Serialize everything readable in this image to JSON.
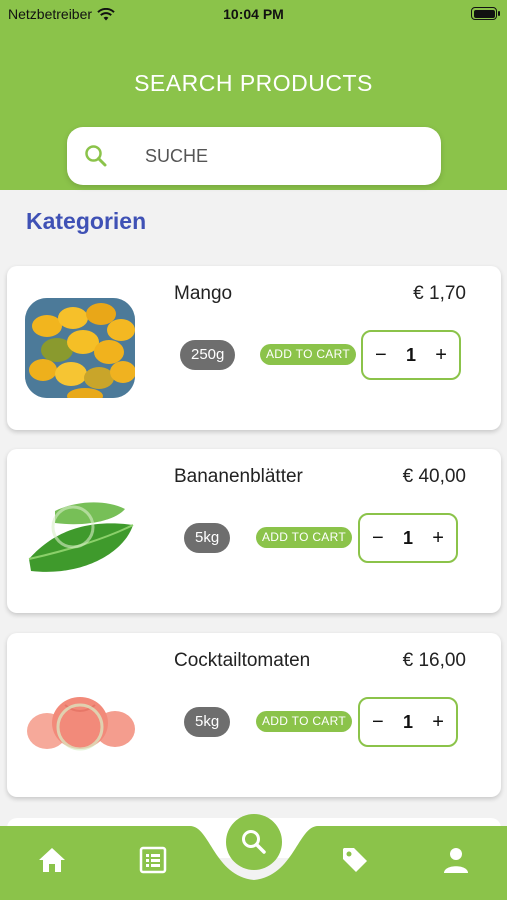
{
  "status_bar": {
    "carrier": "Netzbetreiber",
    "time": "10:04 PM"
  },
  "header": {
    "title": "SEARCH PRODUCTS"
  },
  "search": {
    "placeholder": "SUCHE"
  },
  "section": {
    "title": "Kategorien"
  },
  "colors": {
    "brand_green": "#8bc34a",
    "category_blue": "#3f51b5",
    "badge_grey": "#6e6e6e"
  },
  "products": [
    {
      "name": "Mango",
      "price": "€ 1,70",
      "weight": "250g",
      "add_label": "ADD TO CART",
      "quantity": "1",
      "minus": "−",
      "plus": "+"
    },
    {
      "name": "Bananenblätter",
      "price": "€ 40,00",
      "weight": "5kg",
      "add_label": "ADD TO CART",
      "quantity": "1",
      "minus": "−",
      "plus": "+"
    },
    {
      "name": "Cocktailtomaten",
      "price": "€ 16,00",
      "weight": "5kg",
      "add_label": "ADD TO CART",
      "quantity": "1",
      "minus": "−",
      "plus": "+"
    }
  ],
  "nav": {
    "items": [
      "home-icon",
      "list-icon",
      "search-icon",
      "tag-icon",
      "person-icon"
    ],
    "active": "search-icon"
  }
}
